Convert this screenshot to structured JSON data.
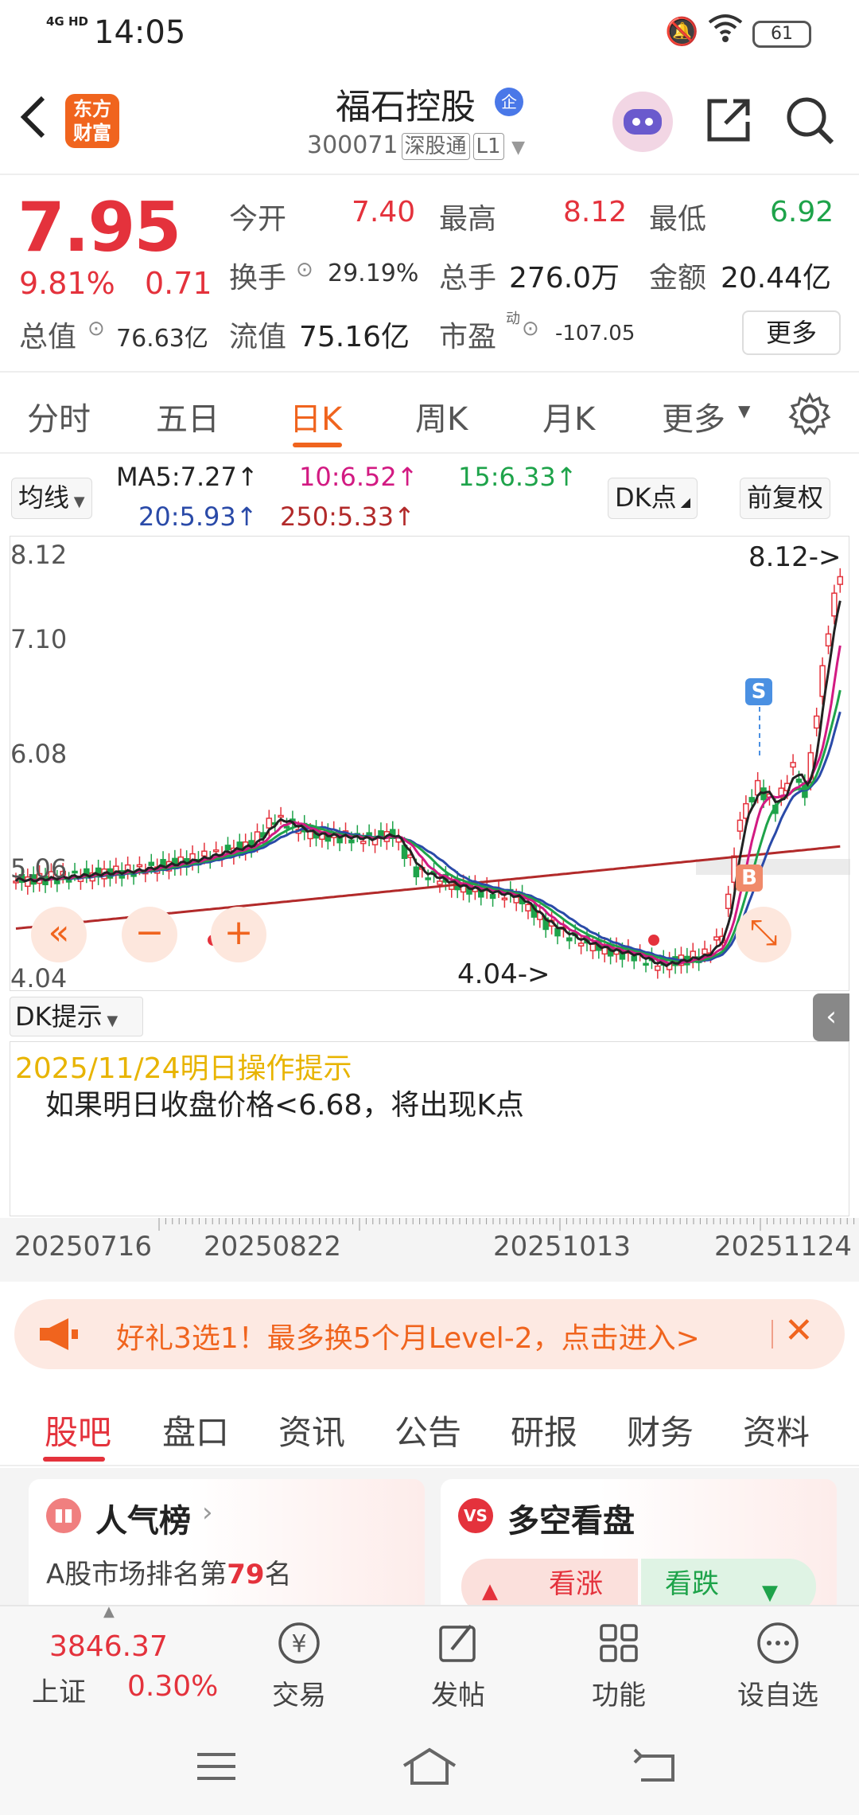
{
  "status": {
    "network": "4G HD",
    "time": "14:05",
    "battery": "61"
  },
  "header": {
    "logo_line1": "东方",
    "logo_line2": "财富",
    "title": "福石控股",
    "title_badge": "企",
    "code": "300071",
    "tags": [
      "深股通",
      "L1"
    ]
  },
  "quote": {
    "price": "7.95",
    "change_pct": "9.81%",
    "change": "0.71",
    "total_value_label": "总值",
    "total_value": "76.63亿",
    "open_label": "今开",
    "open": "7.40",
    "high_label": "最高",
    "high": "8.12",
    "low_label": "最低",
    "low": "6.92",
    "turnover_label": "换手",
    "turnover": "29.19%",
    "volume_label": "总手",
    "volume": "276.0万",
    "amount_label": "金额",
    "amount": "20.44亿",
    "float_label": "流值",
    "float_value": "75.16亿",
    "pe_label": "市盈",
    "pe_sup": "动",
    "pe": "-107.05",
    "more": "更多"
  },
  "ktabs": [
    "分时",
    "五日",
    "日K",
    "周K",
    "月K",
    "更多"
  ],
  "ma": {
    "selector": "均线",
    "ma5": "MA5:7.27↑",
    "ma10": "10:6.52↑",
    "ma15": "15:6.33↑",
    "ma20": "20:5.93↑",
    "ma250": "250:5.33↑",
    "dk_btn": "DK点",
    "fq_btn": "前复权"
  },
  "chart_data": {
    "type": "candlestick",
    "y_ticks": [
      "8.12",
      "7.10",
      "6.08",
      "5.06",
      "4.04"
    ],
    "ylim": [
      4.04,
      8.12
    ],
    "high_annotation": "8.12->",
    "low_annotation": "4.04->",
    "signal_s": "S",
    "signal_b": "B",
    "x_labels": [
      "20250716",
      "20250822",
      "20251013",
      "20251124"
    ],
    "colors": {
      "up": "#e4323c",
      "down": "#1ea34a",
      "ma5": "#222222",
      "ma10": "#d21a82",
      "ma15": "#1ea34a",
      "ma20": "#2a4aa8",
      "ma250": "#b22a2a"
    }
  },
  "dk": {
    "header": "DK提示",
    "date_line": "2025/11/24明日操作提示",
    "tip": "如果明日收盘价格<6.68，将出现K点"
  },
  "promo": {
    "text": "好礼3选1！最多换5个月Level-2，点击进入>"
  },
  "btabs": [
    "股吧",
    "盘口",
    "资讯",
    "公告",
    "研报",
    "财务",
    "资料"
  ],
  "cards": {
    "popularity_title": "人气榜",
    "popularity_desc_prefix": "A股市场排名第",
    "popularity_rank": "79",
    "popularity_desc_suffix": "名",
    "bullbear_title": "多空看盘",
    "bull": "看涨",
    "bear": "看跌"
  },
  "bottom_nav": {
    "index_value": "3846.37",
    "index_name": "上证",
    "index_change": "0.30%",
    "items": [
      "交易",
      "发帖",
      "功能",
      "设自选"
    ]
  }
}
